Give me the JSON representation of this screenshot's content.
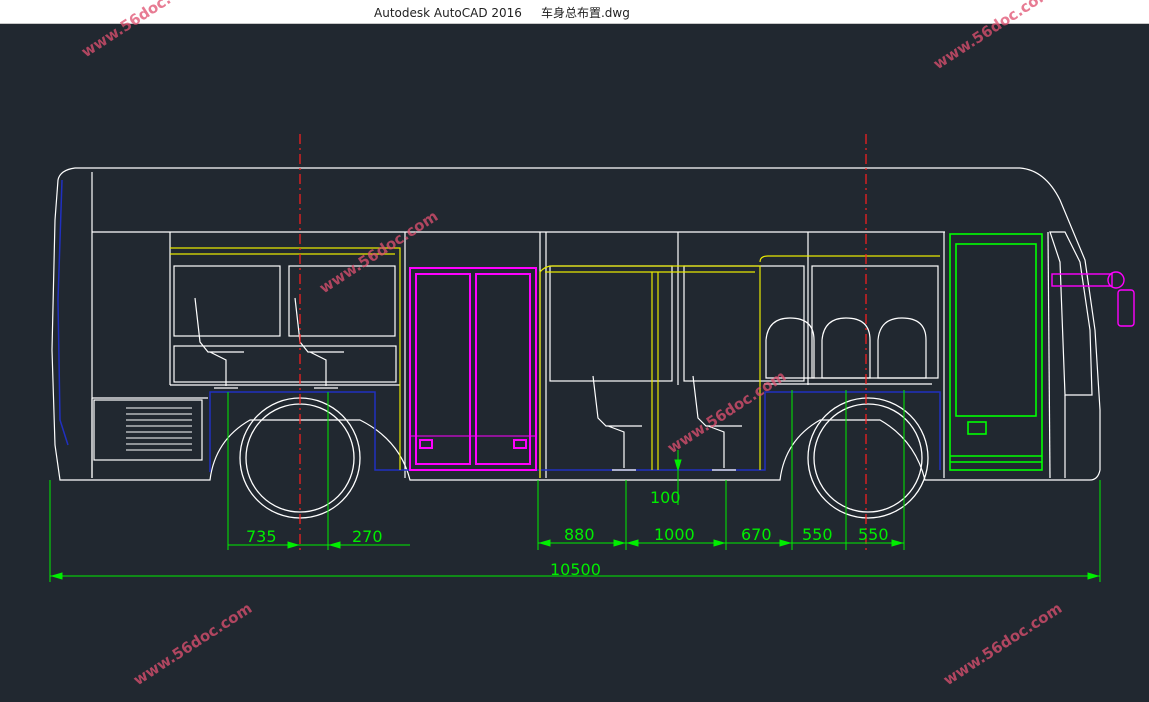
{
  "window": {
    "title": "Autodesk AutoCAD 2016     车身总布置.dwg"
  },
  "watermark": {
    "text": "www.56doc.com"
  },
  "colors": {
    "background": "#212830",
    "outline": "#ffffff",
    "handrail": "#e8e800",
    "door": "#ff00ff",
    "front_door": "#00ff00",
    "dimension": "#00ee00",
    "centerline": "#ff2020",
    "floor": "#2020c0"
  },
  "dimensions": {
    "d735": "735",
    "d270": "270",
    "d880": "880",
    "d1000": "1000",
    "d670": "670",
    "d550a": "550",
    "d550b": "550",
    "d100": "100",
    "total": "10500"
  }
}
